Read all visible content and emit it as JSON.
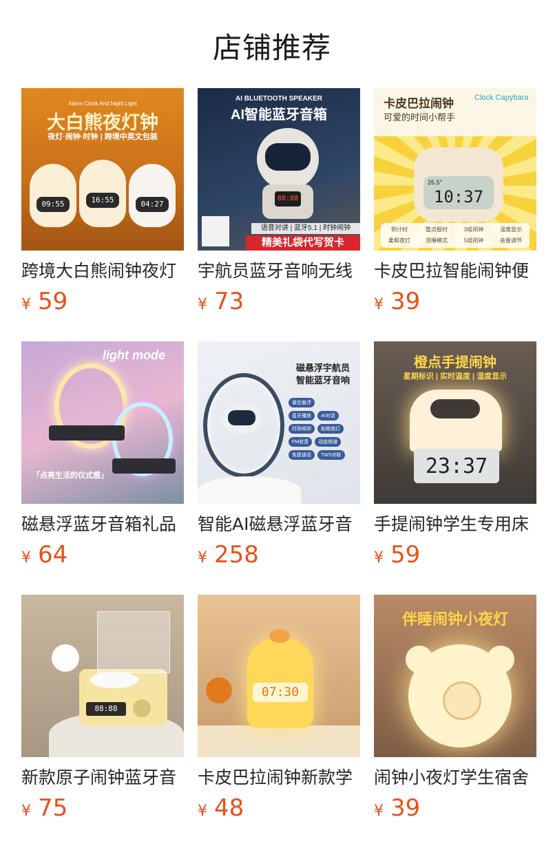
{
  "page": {
    "title": "店铺推荐"
  },
  "products": [
    {
      "name": "跨境大白熊闹钟夜灯",
      "currency": "¥",
      "price": "59",
      "image_text": {
        "small": "Alarm Clock And Night Light",
        "big": "大白熊夜灯钟",
        "sub": "夜灯·闹钟·时钟 | 跨境中英文包装",
        "clocks": [
          "09:55",
          "16:55",
          "04:27"
        ]
      }
    },
    {
      "name": "宇航员蓝牙音响无线",
      "currency": "¥",
      "price": "73",
      "image_text": {
        "small": "AI BLUETOOTH SPEAKER",
        "big": "AI智能蓝牙音箱",
        "sub": "语音对讲 | 蓝牙5.1 | 时钟闹钟",
        "banner": "精美礼袋代写贺卡",
        "clock": "88:88"
      }
    },
    {
      "name": "卡皮巴拉智能闹钟便",
      "currency": "¥",
      "price": "39",
      "image_text": {
        "big": "卡皮巴拉闹钟",
        "sub": "可爱的时间小帮手",
        "brand": "Clock Capybara",
        "clock": "10:37",
        "temp": "26.5°",
        "features": [
          "倒计时",
          "整点报时",
          "3组闹钟",
          "温度显示",
          "柔和夜灯",
          "贪睡模式",
          "5组闹钟",
          "音量调节"
        ]
      }
    },
    {
      "name": "磁悬浮蓝牙音箱礼品",
      "currency": "¥",
      "price": "64",
      "image_text": {
        "big": "light mode",
        "sub": "「点亮生活的仪式感」"
      }
    },
    {
      "name": "智能AI磁悬浮蓝牙音",
      "currency": "¥",
      "price": "258",
      "image_text": {
        "big": "磁悬浮宇航员",
        "sub": "智能蓝牙音响",
        "features": [
          "悬空悬浮",
          "蓝牙播放",
          "AI对话",
          "时钟闹钟",
          "助眠夜灯",
          "FM收音",
          "动态频谱",
          "免提通话",
          "TWS对联"
        ]
      }
    },
    {
      "name": "手提闹钟学生专用床",
      "currency": "¥",
      "price": "59",
      "image_text": {
        "big": "橙点手提闹钟",
        "sub": "星期标识 | 实时温度 | 湿度显示",
        "clock": "23:37"
      }
    },
    {
      "name": "新款原子闹钟蓝牙音",
      "currency": "¥",
      "price": "75",
      "image_text": {
        "clock": "88:88"
      }
    },
    {
      "name": "卡皮巴拉闹钟新款学",
      "currency": "¥",
      "price": "48",
      "image_text": {
        "clock": "07:30"
      }
    },
    {
      "name": "闹钟小夜灯学生宿舍",
      "currency": "¥",
      "price": "39",
      "image_text": {
        "big": "伴睡闹钟小夜灯"
      }
    }
  ],
  "colors": {
    "price": "#e8501a",
    "title": "#1a1a1a",
    "name": "#262626"
  }
}
